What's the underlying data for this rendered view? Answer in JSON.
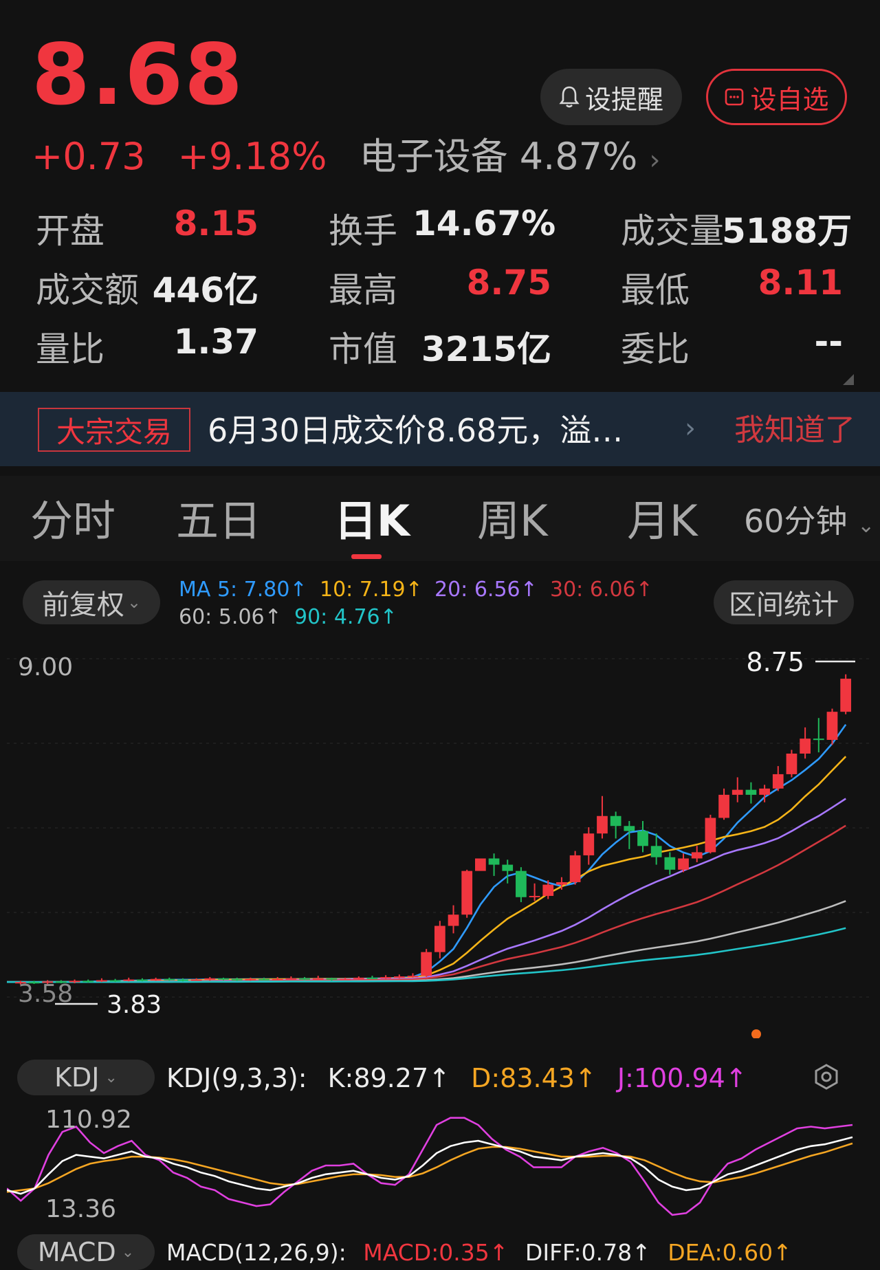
{
  "quote": {
    "price": "8.68",
    "change": "+0.73",
    "change_pct": "+9.18%",
    "sector": "电子设备 4.87%",
    "sector_arrow": "›"
  },
  "actions": {
    "alert_label": "设提醒",
    "watch_label": "设自选"
  },
  "stats": [
    {
      "label": "开盘",
      "value": "8.15",
      "color": "#f0363f"
    },
    {
      "label": "换手",
      "value": "14.67%",
      "color": "#ececec"
    },
    {
      "label": "成交量",
      "value": "5188万",
      "color": "#ececec"
    },
    {
      "label": "成交额",
      "value": "446亿",
      "color": "#ececec"
    },
    {
      "label": "最高",
      "value": "8.75",
      "color": "#f0363f"
    },
    {
      "label": "最低",
      "value": "8.11",
      "color": "#f0363f"
    },
    {
      "label": "量比",
      "value": "1.37",
      "color": "#ececec"
    },
    {
      "label": "市值",
      "value": "3215亿",
      "color": "#ececec"
    },
    {
      "label": "委比",
      "value": "--",
      "color": "#ececec"
    }
  ],
  "notice": {
    "tag": "大宗交易",
    "text": "6月30日成交价8.68元，溢…",
    "arrow": "›",
    "dismiss": "我知道了"
  },
  "tabs": {
    "items": [
      "分时",
      "五日",
      "日K",
      "周K",
      "月K"
    ],
    "active": "日K",
    "interval": "60分钟"
  },
  "kline": {
    "adjust_label": "前复权",
    "range_label": "区间统计",
    "ma": [
      {
        "label": "MA 5: 7.80↑",
        "color": "#2f9bff"
      },
      {
        "label": "10: 7.19↑",
        "color": "#f5b418"
      },
      {
        "label": "20: 6.56↑",
        "color": "#a878ff"
      },
      {
        "label": "30: 6.06↑",
        "color": "#d2383f"
      },
      {
        "label": "60: 5.06↑",
        "color": "#bdbdbd"
      },
      {
        "label": "90: 4.76↑",
        "color": "#22c4c8"
      }
    ],
    "axis_top": "9.00",
    "axis_bottom": "3.58",
    "high_label": "8.75",
    "low_label": "3.83"
  },
  "kdj": {
    "chip": "KDJ",
    "title": "KDJ(9,3,3):",
    "k": "K:89.27↑",
    "d": "D:83.43↑",
    "j": "J:100.94↑",
    "axis_top": "110.92",
    "axis_bottom": "13.36",
    "colors": {
      "k": "#ffffff",
      "d": "#f5a623",
      "j": "#e040e0"
    }
  },
  "macd": {
    "chip": "MACD",
    "title": "MACD(12,26,9):",
    "macd": "MACD:0.35↑",
    "diff": "DIFF:0.78↑",
    "dea": "DEA:0.60↑"
  },
  "chart_data": {
    "type": "candlestick",
    "series_ma": [
      {
        "name": "MA5",
        "color": "#2f9bff"
      },
      {
        "name": "MA10",
        "color": "#f5b418"
      },
      {
        "name": "MA20",
        "color": "#a878ff"
      },
      {
        "name": "MA30",
        "color": "#d2383f"
      },
      {
        "name": "MA60",
        "color": "#bdbdbd"
      },
      {
        "name": "MA90",
        "color": "#22c4c8"
      }
    ],
    "ylim": [
      3.58,
      9.0
    ],
    "candles": [
      [
        3.8,
        3.82,
        3.84,
        3.78
      ],
      [
        3.82,
        3.81,
        3.84,
        3.79
      ],
      [
        3.81,
        3.83,
        3.85,
        3.79
      ],
      [
        3.83,
        3.82,
        3.85,
        3.8
      ],
      [
        3.82,
        3.84,
        3.86,
        3.8
      ],
      [
        3.84,
        3.83,
        3.86,
        3.81
      ],
      [
        3.83,
        3.85,
        3.88,
        3.82
      ],
      [
        3.85,
        3.84,
        3.87,
        3.82
      ],
      [
        3.84,
        3.86,
        3.89,
        3.83
      ],
      [
        3.86,
        3.85,
        3.88,
        3.83
      ],
      [
        3.85,
        3.87,
        3.89,
        3.84
      ],
      [
        3.87,
        3.86,
        3.89,
        3.84
      ],
      [
        3.86,
        3.85,
        3.88,
        3.83
      ],
      [
        3.85,
        3.86,
        3.88,
        3.84
      ],
      [
        3.86,
        3.88,
        3.9,
        3.84
      ],
      [
        3.88,
        3.87,
        3.89,
        3.85
      ],
      [
        3.87,
        3.86,
        3.89,
        3.84
      ],
      [
        3.86,
        3.87,
        3.89,
        3.84
      ],
      [
        3.87,
        3.86,
        3.89,
        3.85
      ],
      [
        3.86,
        3.87,
        3.9,
        3.85
      ],
      [
        3.87,
        3.88,
        3.91,
        3.86
      ],
      [
        3.88,
        3.87,
        3.9,
        3.85
      ],
      [
        3.87,
        3.88,
        3.92,
        3.86
      ],
      [
        3.88,
        3.86,
        3.89,
        3.84
      ],
      [
        3.86,
        3.87,
        3.89,
        3.85
      ],
      [
        3.87,
        3.89,
        3.91,
        3.86
      ],
      [
        3.89,
        3.88,
        3.92,
        3.87
      ],
      [
        3.88,
        3.9,
        3.93,
        3.87
      ],
      [
        3.9,
        3.91,
        3.94,
        3.88
      ],
      [
        3.91,
        3.92,
        3.96,
        3.89
      ],
      [
        3.92,
        4.3,
        4.35,
        3.9
      ],
      [
        4.3,
        4.72,
        4.8,
        4.2
      ],
      [
        4.72,
        4.9,
        5.05,
        4.6
      ],
      [
        4.9,
        5.6,
        5.62,
        4.85
      ],
      [
        5.6,
        5.8,
        5.7,
        5.75
      ],
      [
        5.8,
        5.7,
        5.88,
        5.52
      ],
      [
        5.7,
        5.6,
        5.78,
        5.4
      ],
      [
        5.6,
        5.18,
        5.66,
        5.1
      ],
      [
        5.18,
        5.2,
        5.4,
        5.12
      ],
      [
        5.2,
        5.38,
        5.45,
        5.15
      ],
      [
        5.38,
        5.42,
        5.5,
        5.3
      ],
      [
        5.42,
        5.85,
        5.92,
        5.38
      ],
      [
        5.85,
        6.2,
        6.3,
        5.7
      ],
      [
        6.2,
        6.48,
        6.8,
        6.12
      ],
      [
        6.48,
        6.32,
        6.55,
        6.12
      ],
      [
        6.32,
        6.24,
        6.4,
        5.95
      ],
      [
        6.24,
        6.0,
        6.4,
        5.9
      ],
      [
        6.0,
        5.82,
        6.2,
        5.7
      ],
      [
        5.82,
        5.62,
        5.9,
        5.54
      ],
      [
        5.62,
        5.8,
        5.88,
        5.58
      ],
      [
        5.8,
        5.9,
        6.0,
        5.74
      ],
      [
        5.9,
        6.45,
        6.5,
        5.88
      ],
      [
        6.45,
        6.82,
        6.92,
        6.42
      ],
      [
        6.82,
        6.9,
        7.1,
        6.7
      ],
      [
        6.9,
        6.82,
        7.02,
        6.68
      ],
      [
        6.82,
        6.92,
        6.98,
        6.7
      ],
      [
        6.92,
        7.15,
        7.28,
        6.88
      ],
      [
        7.15,
        7.48,
        7.54,
        7.1
      ],
      [
        7.48,
        7.72,
        7.9,
        7.4
      ],
      [
        7.72,
        7.7,
        8.05,
        7.5
      ],
      [
        7.7,
        8.15,
        8.2,
        7.62
      ],
      [
        8.15,
        8.68,
        8.75,
        8.11
      ]
    ],
    "kdj_k": [
      22,
      18,
      24,
      40,
      55,
      62,
      60,
      58,
      62,
      66,
      60,
      58,
      52,
      48,
      42,
      38,
      32,
      28,
      24,
      22,
      26,
      30,
      36,
      40,
      42,
      44,
      40,
      36,
      34,
      38,
      50,
      64,
      72,
      76,
      78,
      74,
      70,
      66,
      60,
      58,
      56,
      60,
      62,
      64,
      62,
      58,
      48,
      34,
      26,
      22,
      24,
      32,
      40,
      44,
      50,
      56,
      62,
      68,
      72,
      74,
      78,
      82
    ],
    "kdj_d": [
      20,
      22,
      24,
      30,
      38,
      46,
      52,
      55,
      57,
      60,
      60,
      59,
      57,
      54,
      50,
      46,
      42,
      38,
      34,
      30,
      28,
      29,
      32,
      35,
      38,
      40,
      40,
      39,
      37,
      37,
      41,
      48,
      56,
      63,
      69,
      71,
      71,
      69,
      66,
      63,
      60,
      60,
      60,
      61,
      61,
      60,
      56,
      49,
      42,
      36,
      32,
      31,
      34,
      37,
      41,
      46,
      51,
      56,
      61,
      65,
      70,
      75
    ],
    "kdj_j": [
      24,
      10,
      24,
      62,
      88,
      94,
      76,
      64,
      72,
      78,
      62,
      56,
      42,
      36,
      26,
      22,
      12,
      8,
      4,
      6,
      20,
      32,
      44,
      50,
      50,
      52,
      40,
      30,
      28,
      40,
      68,
      96,
      104,
      104,
      96,
      80,
      68,
      60,
      48,
      48,
      48,
      60,
      66,
      70,
      64,
      54,
      32,
      8,
      -6,
      -4,
      8,
      34,
      52,
      58,
      68,
      76,
      84,
      92,
      94,
      92,
      94,
      96
    ]
  }
}
